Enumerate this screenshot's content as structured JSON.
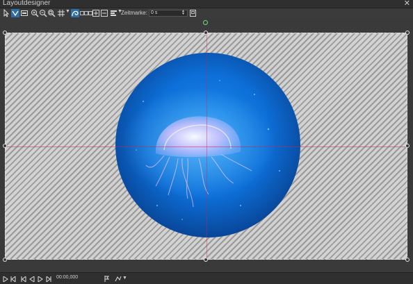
{
  "window": {
    "title": "Layoutdesigner",
    "close_glyph": "✕"
  },
  "toolbar": {
    "tools": [
      {
        "name": "select-icon"
      },
      {
        "name": "multi-select-icon"
      },
      {
        "name": "fit-icon"
      },
      {
        "name": "zoom-in-icon"
      },
      {
        "name": "zoom-out-icon"
      },
      {
        "name": "zoom-fit-icon"
      },
      {
        "name": "grid-icon"
      },
      {
        "name": "curve-icon"
      },
      {
        "name": "keyframe-icon"
      },
      {
        "name": "plus-icon"
      },
      {
        "name": "minus-icon"
      },
      {
        "name": "align-icon"
      }
    ],
    "zeitmarke_label": "Zeitmarke:",
    "zeitmarke_value": "0 s",
    "save_icon": "save-icon"
  },
  "canvas": {
    "pattern": "diagonal-stripes",
    "photo": "jellyfish-circle",
    "accent_guide_color": "#c82850",
    "rotation_handle_color": "#6fe07a",
    "selection_color": "#2c6ea8"
  },
  "playback": {
    "buttons": [
      "play-icon",
      "step-back-icon",
      "prev-icon",
      "back-icon",
      "forward-icon",
      "next-icon"
    ],
    "timecode": "00:00,000",
    "marker_icon": "marker-icon",
    "mode_icon": "mode-icon"
  }
}
